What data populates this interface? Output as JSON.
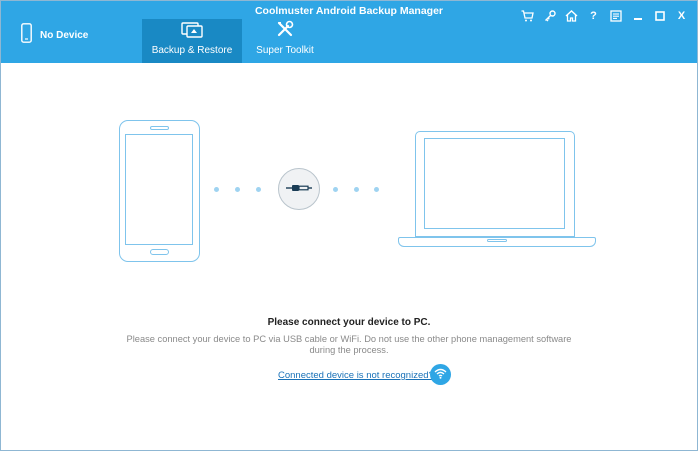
{
  "window": {
    "title": "Coolmuster Android Backup Manager"
  },
  "device": {
    "label": "No Device",
    "icon": "phone-icon"
  },
  "tabs": [
    {
      "label": "Backup & Restore",
      "icon": "backup-restore-icon",
      "active": true
    },
    {
      "label": "Super Toolkit",
      "icon": "toolkit-icon",
      "active": false
    }
  ],
  "title_bar_icons": [
    "cart-icon",
    "key-icon",
    "home-icon",
    "help-icon",
    "feedback-icon",
    "minimize-icon",
    "maximize-icon",
    "close-icon"
  ],
  "title_bar_glyphs": {
    "help": "?",
    "close": "X"
  },
  "main": {
    "headline": "Please connect your device to PC.",
    "description": "Please connect your device to PC via USB cable or WiFi. Do not use the other phone management software during the process.",
    "help_link": "Connected device is not recognized?"
  },
  "colors": {
    "header": "#2fa6e5",
    "active_tab": "#1989c4",
    "illustration_stroke": "#7fc4ec",
    "link": "#1a72b8"
  }
}
